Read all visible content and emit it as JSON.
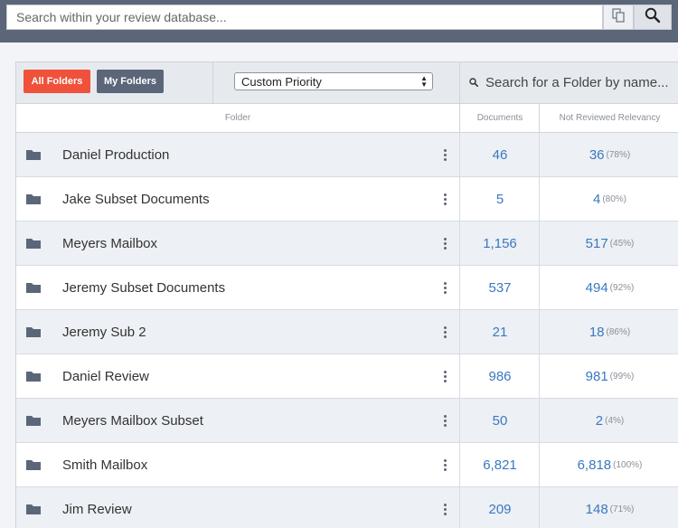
{
  "search": {
    "placeholder": "Search within your review database..."
  },
  "icons": {
    "copy": "copy-icon",
    "search": "search-icon",
    "folder": "folder-icon",
    "menu": "kebab-menu-icon"
  },
  "toolbar": {
    "all_folders_label": "All Folders",
    "my_folders_label": "My Folders",
    "sort_select_value": "Custom Priority",
    "folder_search_placeholder": "Search for a Folder by name..."
  },
  "colors": {
    "accent_red": "#f0513a",
    "nav_slate": "#5b6679",
    "link_blue": "#3a78c3"
  },
  "table": {
    "columns": [
      "Folder",
      "Documents",
      "Not Reviewed Relevancy"
    ],
    "rows": [
      {
        "name": "Daniel Production",
        "documents": "46",
        "not_reviewed": "36",
        "percent": "(78%)"
      },
      {
        "name": "Jake Subset Documents",
        "documents": "5",
        "not_reviewed": "4",
        "percent": "(80%)"
      },
      {
        "name": "Meyers Mailbox",
        "documents": "1,156",
        "not_reviewed": "517",
        "percent": "(45%)"
      },
      {
        "name": "Jeremy Subset Documents",
        "documents": "537",
        "not_reviewed": "494",
        "percent": "(92%)"
      },
      {
        "name": "Jeremy Sub 2",
        "documents": "21",
        "not_reviewed": "18",
        "percent": "(86%)"
      },
      {
        "name": "Daniel Review",
        "documents": "986",
        "not_reviewed": "981",
        "percent": "(99%)"
      },
      {
        "name": "Meyers Mailbox Subset",
        "documents": "50",
        "not_reviewed": "2",
        "percent": "(4%)"
      },
      {
        "name": "Smith Mailbox",
        "documents": "6,821",
        "not_reviewed": "6,818",
        "percent": "(100%)"
      },
      {
        "name": "Jim Review",
        "documents": "209",
        "not_reviewed": "148",
        "percent": "(71%)"
      }
    ]
  }
}
